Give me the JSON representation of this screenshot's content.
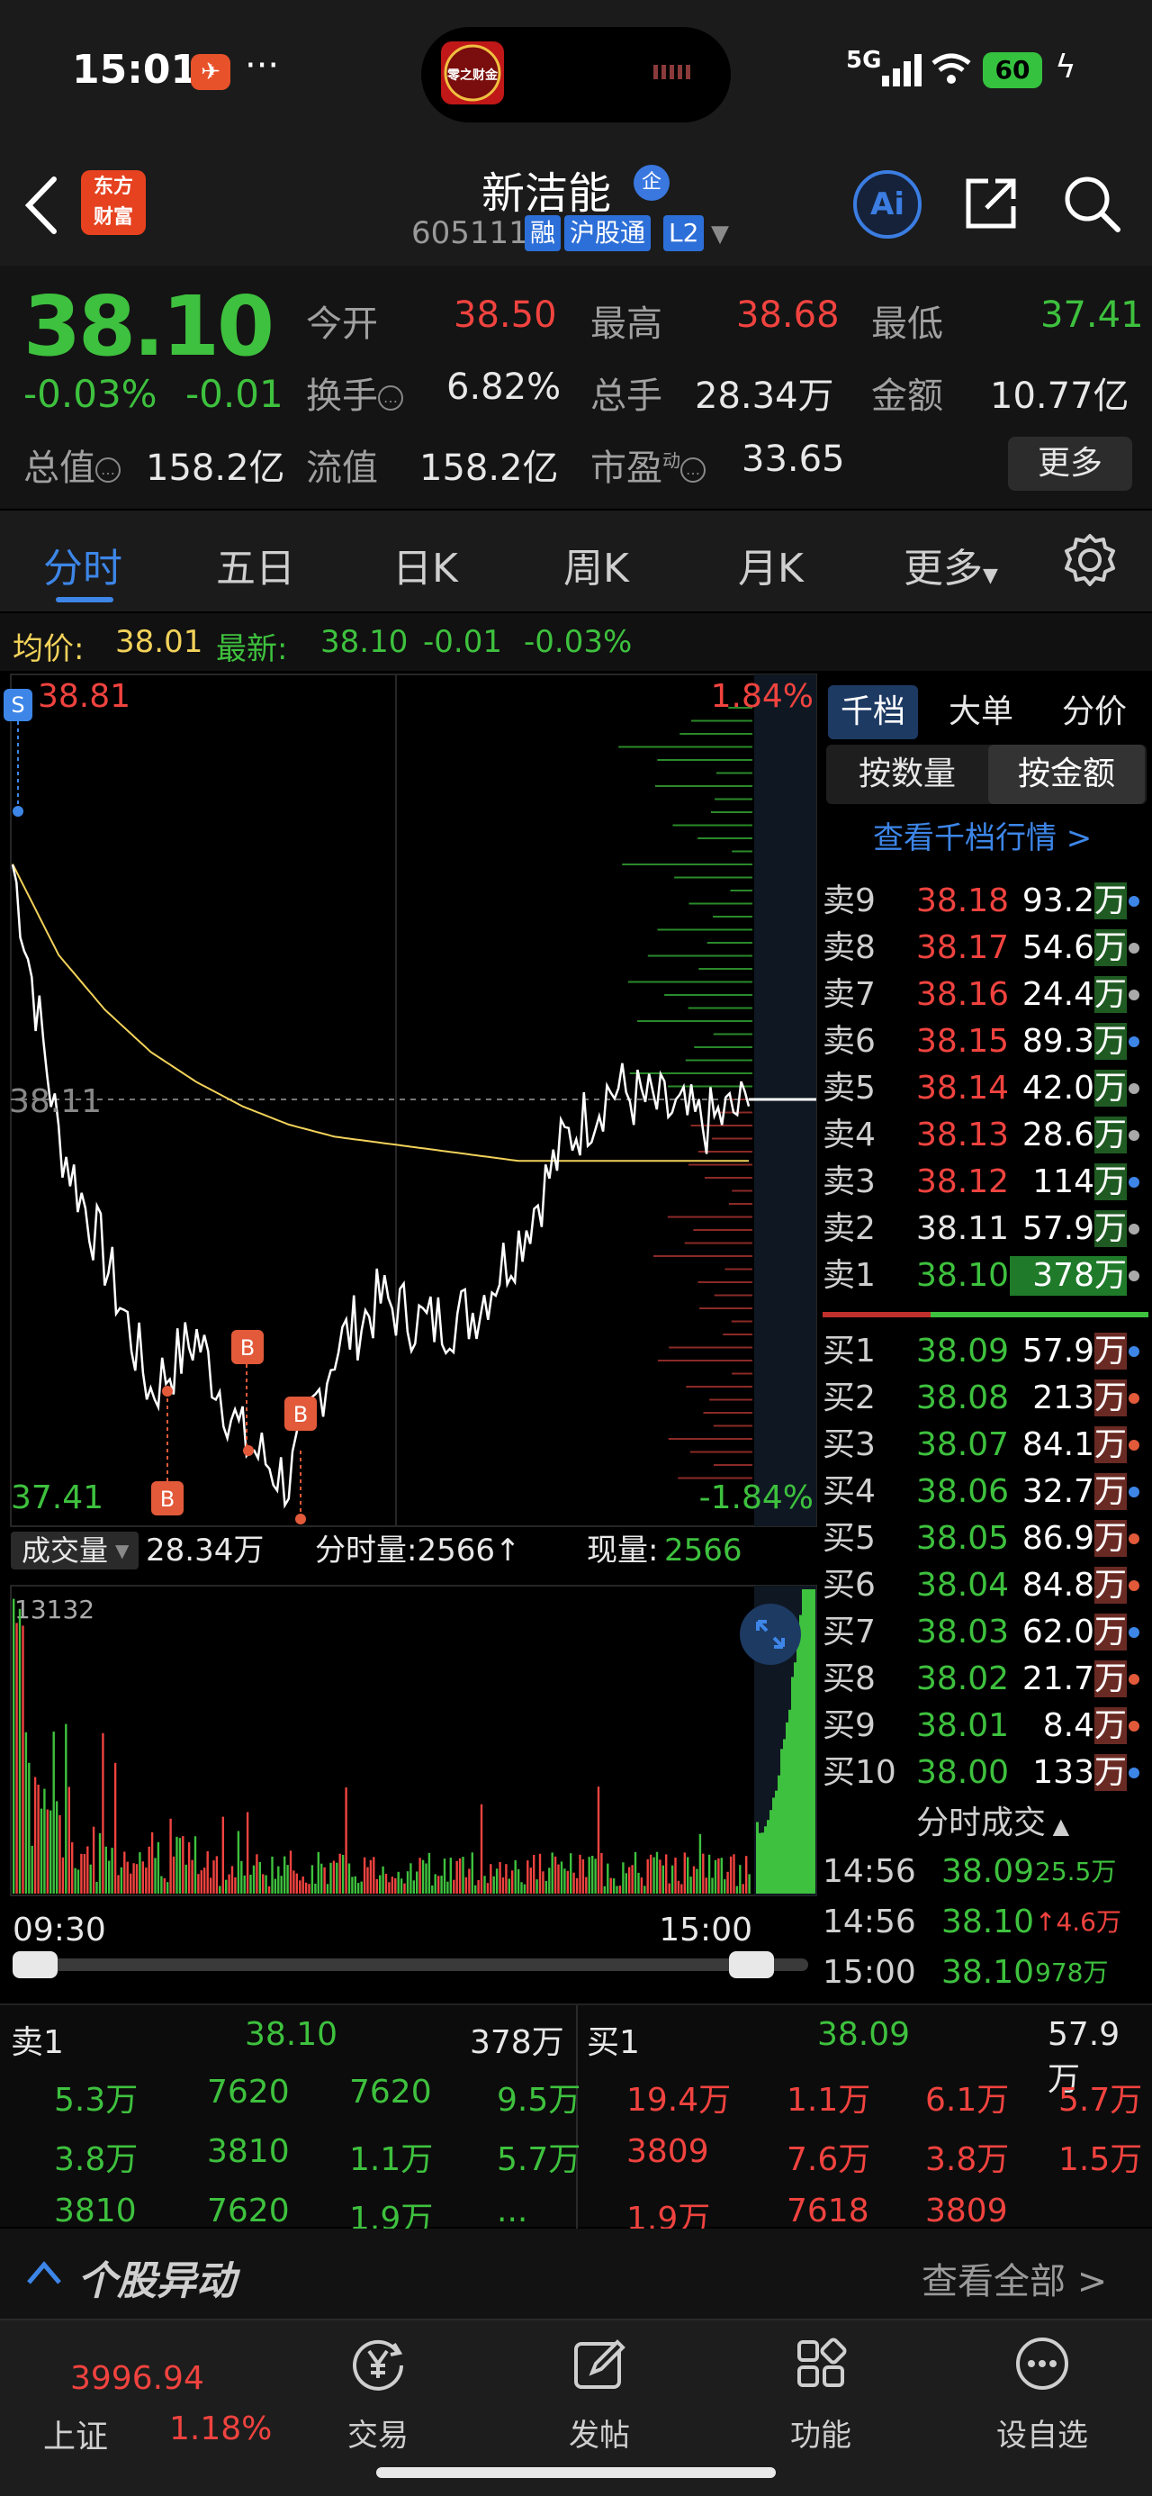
{
  "status_bar": {
    "time": "15:01",
    "dots": "···",
    "network": "5G",
    "battery": "60"
  },
  "header": {
    "name": "新洁能",
    "qi_badge": "企",
    "code": "605111",
    "tags": [
      "融",
      "沪股通",
      "L2"
    ],
    "logo_line1": "东方",
    "logo_line2": "财富",
    "ai_label": "Ai",
    "island_logo": "零之财金"
  },
  "quote": {
    "price": "38.10",
    "change_pct": "-0.03%",
    "change": "-0.01",
    "open_label": "今开",
    "open": "38.50",
    "high_label": "最高",
    "high": "38.68",
    "low_label": "最低",
    "low": "37.41",
    "turnover_label": "换手",
    "turnover": "6.82%",
    "volume_label": "总手",
    "volume": "28.34万",
    "amount_label": "金额",
    "amount": "10.77亿",
    "mktcap_label": "总值",
    "mktcap": "158.2亿",
    "float_label": "流值",
    "float": "158.2亿",
    "pe_label": "市盈",
    "pe_sup": "动",
    "pe": "33.65",
    "more": "更多"
  },
  "tabs": [
    "分时",
    "五日",
    "日K",
    "周K",
    "月K",
    "更多"
  ],
  "avg_bar": {
    "avg_label": "均价:",
    "avg": "38.01",
    "latest_label": "最新:",
    "latest": "38.10",
    "chg": "-0.01",
    "pct": "-0.03%"
  },
  "chart": {
    "top_price": "38.81",
    "mid_price": "38.11",
    "low_price": "37.41",
    "top_pct": "1.84%",
    "low_pct": "-1.84%",
    "marker_s": "S",
    "marker_b": "B",
    "vol_label": "成交量",
    "vol_total": "28.34万",
    "minute_vol": "分时量:2566↑",
    "now_vol_label": "现量:",
    "now_vol": "2566",
    "vol_max": "13132",
    "time_start": "09:30",
    "time_end": "15:00"
  },
  "chart_data": {
    "type": "line",
    "title": "",
    "xlabel": "",
    "ylabel": "",
    "ylim": [
      37.41,
      38.81
    ],
    "x": [
      "09:30",
      "09:45",
      "10:00",
      "10:15",
      "10:30",
      "10:45",
      "11:00",
      "11:15",
      "11:30/13:00",
      "13:15",
      "13:30",
      "13:45",
      "14:00",
      "14:15",
      "14:30",
      "14:45",
      "15:00"
    ],
    "series": [
      {
        "name": "",
        "values": [
          38.5,
          38.05,
          37.85,
          37.63,
          37.72,
          37.55,
          37.48,
          37.7,
          37.78,
          37.74,
          37.76,
          37.88,
          38.04,
          38.13,
          38.1,
          38.07,
          38.1
        ]
      },
      {
        "name": "均价",
        "values": [
          38.5,
          38.35,
          38.26,
          38.19,
          38.14,
          38.1,
          38.07,
          38.05,
          38.04,
          38.03,
          38.02,
          38.01,
          38.01,
          38.01,
          38.01,
          38.01,
          38.01
        ]
      }
    ]
  },
  "book": {
    "tabs": [
      "千档",
      "大单",
      "分价"
    ],
    "toggle": [
      "按数量",
      "按金额"
    ],
    "link": "查看千档行情 >",
    "asks": [
      {
        "label": "卖9",
        "price": "38.18",
        "vol": "93.2",
        "unit": "万"
      },
      {
        "label": "卖8",
        "price": "38.17",
        "vol": "54.6",
        "unit": "万"
      },
      {
        "label": "卖7",
        "price": "38.16",
        "vol": "24.4",
        "unit": "万"
      },
      {
        "label": "卖6",
        "price": "38.15",
        "vol": "89.3",
        "unit": "万"
      },
      {
        "label": "卖5",
        "price": "38.14",
        "vol": "42.0",
        "unit": "万"
      },
      {
        "label": "卖4",
        "price": "38.13",
        "vol": "28.6",
        "unit": "万"
      },
      {
        "label": "卖3",
        "price": "38.12",
        "vol": "114",
        "unit": "万"
      },
      {
        "label": "卖2",
        "price": "38.11",
        "vol": "57.9",
        "unit": "万"
      },
      {
        "label": "卖1",
        "price": "38.10",
        "vol": "378",
        "unit": "万"
      }
    ],
    "bids": [
      {
        "label": "买1",
        "price": "38.09",
        "vol": "57.9",
        "unit": "万"
      },
      {
        "label": "买2",
        "price": "38.08",
        "vol": "213",
        "unit": "万"
      },
      {
        "label": "买3",
        "price": "38.07",
        "vol": "84.1",
        "unit": "万"
      },
      {
        "label": "买4",
        "price": "38.06",
        "vol": "32.7",
        "unit": "万"
      },
      {
        "label": "买5",
        "price": "38.05",
        "vol": "86.9",
        "unit": "万"
      },
      {
        "label": "买6",
        "price": "38.04",
        "vol": "84.8",
        "unit": "万"
      },
      {
        "label": "买7",
        "price": "38.03",
        "vol": "62.0",
        "unit": "万"
      },
      {
        "label": "买8",
        "price": "38.02",
        "vol": "21.7",
        "unit": "万"
      },
      {
        "label": "买9",
        "price": "38.01",
        "vol": "8.4",
        "unit": "万"
      },
      {
        "label": "买10",
        "price": "38.00",
        "vol": "133",
        "unit": "万"
      }
    ],
    "ticks_title": "分时成交",
    "ticks": [
      {
        "time": "14:56",
        "price": "38.09",
        "vol": "25.5万"
      },
      {
        "time": "14:56",
        "price": "38.10",
        "vol": "↑4.6万"
      },
      {
        "time": "15:00",
        "price": "38.10",
        "vol": "978万"
      }
    ]
  },
  "trades": {
    "left_head": {
      "label": "卖1",
      "price": "38.10",
      "amt": "378万"
    },
    "right_head": {
      "label": "买1",
      "price": "38.09",
      "amt": "57.9万"
    },
    "left_rows": [
      [
        "5.3万",
        "7620",
        "7620",
        "9.5万"
      ],
      [
        "3.8万",
        "3810",
        "1.1万",
        "5.7万"
      ],
      [
        "3810",
        "7620",
        "1.9万",
        "..."
      ]
    ],
    "right_rows": [
      [
        "19.4万",
        "1.1万",
        "6.1万",
        "5.7万"
      ],
      [
        "3809",
        "7.6万",
        "3.8万",
        "1.5万"
      ],
      [
        "1.9万",
        "7618",
        "3809",
        ""
      ]
    ]
  },
  "news": {
    "title": "个股异动",
    "view_all": "查看全部 >"
  },
  "nav": {
    "index_value": "3996.94",
    "index_name": "上证",
    "index_pct": "1.18%",
    "items": [
      "交易",
      "发帖",
      "功能",
      "设自选"
    ]
  },
  "colors": {
    "up": "#f0433f",
    "down": "#3ec13e",
    "accent": "#3d86e8",
    "avg_line": "#f2d25a"
  }
}
